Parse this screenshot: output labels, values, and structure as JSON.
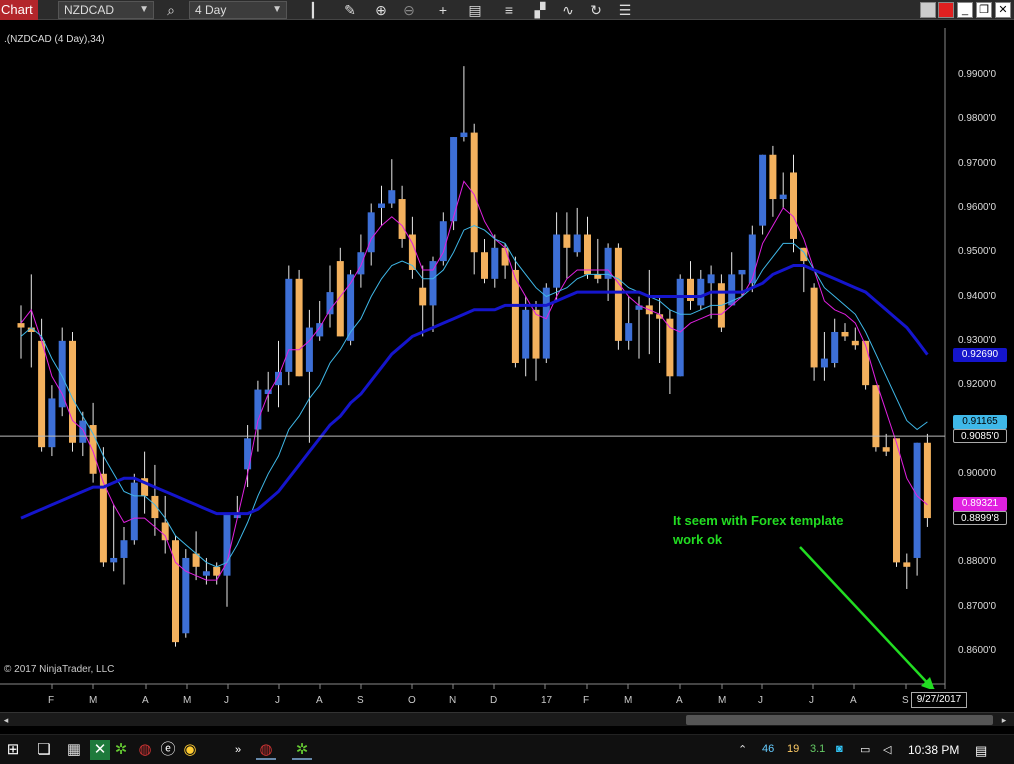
{
  "toolbar": {
    "tab_label": "Chart",
    "instrument": "NZDCAD",
    "period": "4 Day",
    "colors": {
      "tab": "#b3262b",
      "bar": "#2b2b2b"
    },
    "icons": [
      "search-icon",
      "candlestick-icon",
      "pencil-icon",
      "zoom-in-icon",
      "zoom-out-icon",
      "crosshair-icon",
      "data-box-icon",
      "bars-icon",
      "strategy-icon",
      "indicator-icon",
      "refresh-icon",
      "properties-icon"
    ],
    "window_buttons": [
      "restore-icon",
      "close-red-icon",
      "minimize-icon",
      "maximize-icon",
      "close-icon"
    ]
  },
  "chart": {
    "title": ".(NZDCAD (4 Day),34)",
    "copyright": "© 2017 NinjaTrader, LLC",
    "annotation_line1": "It seem with Forex template",
    "annotation_line2": "work ok",
    "date_tag": "9/27/2017",
    "price_ticks": [
      "0.9900'0",
      "0.9800'0",
      "0.9700'0",
      "0.9600'0",
      "0.9500'0",
      "0.9400'0",
      "0.9300'0",
      "0.9200'0",
      "0.9100'0",
      "0.9000'0",
      "0.8900'0",
      "0.8800'0",
      "0.8700'0",
      "0.8600'0"
    ],
    "price_tags": [
      {
        "text": "0.92690",
        "color": "#1515cc",
        "fg": "#ffffff"
      },
      {
        "text": "0.91165",
        "color": "#3fb8e8",
        "fg": "#000000"
      },
      {
        "text": "0.9085'0",
        "color": "#000000",
        "fg": "#ffffff"
      },
      {
        "text": "0.89321",
        "color": "#e020e0",
        "fg": "#ffffff"
      },
      {
        "text": "0.8899'8",
        "color": "#000000",
        "fg": "#ffffff"
      }
    ],
    "month_labels": [
      "F",
      "M",
      "A",
      "M",
      "J",
      "J",
      "A",
      "S",
      "O",
      "N",
      "D",
      "17",
      "F",
      "M",
      "A",
      "M",
      "J",
      "J",
      "A",
      "S"
    ],
    "colors": {
      "up": "#3d6fd6",
      "down": "#f3b15e",
      "ema_fast": "#e020e0",
      "ema_mid": "#3fb8e8",
      "ema_slow": "#1515cc",
      "annotation": "#22dd22"
    }
  },
  "chart_data": {
    "type": "candlestick",
    "instrument": "NZDCAD",
    "period": "4 Day",
    "ylim": [
      0.855,
      0.995
    ],
    "current_price": 0.9085,
    "candles": [
      {
        "o": 0.934,
        "h": 0.938,
        "l": 0.926,
        "c": 0.933
      },
      {
        "o": 0.933,
        "h": 0.945,
        "l": 0.924,
        "c": 0.932
      },
      {
        "o": 0.93,
        "h": 0.935,
        "l": 0.905,
        "c": 0.906
      },
      {
        "o": 0.906,
        "h": 0.92,
        "l": 0.904,
        "c": 0.917
      },
      {
        "o": 0.915,
        "h": 0.933,
        "l": 0.913,
        "c": 0.93
      },
      {
        "o": 0.93,
        "h": 0.932,
        "l": 0.905,
        "c": 0.907
      },
      {
        "o": 0.907,
        "h": 0.914,
        "l": 0.904,
        "c": 0.912
      },
      {
        "o": 0.911,
        "h": 0.916,
        "l": 0.898,
        "c": 0.9
      },
      {
        "o": 0.9,
        "h": 0.906,
        "l": 0.879,
        "c": 0.88
      },
      {
        "o": 0.88,
        "h": 0.893,
        "l": 0.878,
        "c": 0.881
      },
      {
        "o": 0.881,
        "h": 0.888,
        "l": 0.875,
        "c": 0.885
      },
      {
        "o": 0.885,
        "h": 0.9,
        "l": 0.884,
        "c": 0.898
      },
      {
        "o": 0.899,
        "h": 0.905,
        "l": 0.891,
        "c": 0.895
      },
      {
        "o": 0.895,
        "h": 0.902,
        "l": 0.886,
        "c": 0.89
      },
      {
        "o": 0.889,
        "h": 0.895,
        "l": 0.882,
        "c": 0.885
      },
      {
        "o": 0.885,
        "h": 0.886,
        "l": 0.861,
        "c": 0.862
      },
      {
        "o": 0.864,
        "h": 0.883,
        "l": 0.863,
        "c": 0.881
      },
      {
        "o": 0.882,
        "h": 0.887,
        "l": 0.876,
        "c": 0.879
      },
      {
        "o": 0.877,
        "h": 0.881,
        "l": 0.875,
        "c": 0.878
      },
      {
        "o": 0.879,
        "h": 0.88,
        "l": 0.875,
        "c": 0.877
      },
      {
        "o": 0.877,
        "h": 0.887,
        "l": 0.87,
        "c": 0.891
      },
      {
        "o": 0.89,
        "h": 0.895,
        "l": 0.89,
        "c": 0.891
      },
      {
        "o": 0.901,
        "h": 0.911,
        "l": 0.897,
        "c": 0.908
      },
      {
        "o": 0.91,
        "h": 0.921,
        "l": 0.905,
        "c": 0.919
      },
      {
        "o": 0.918,
        "h": 0.923,
        "l": 0.914,
        "c": 0.919
      },
      {
        "o": 0.92,
        "h": 0.93,
        "l": 0.915,
        "c": 0.923
      },
      {
        "o": 0.923,
        "h": 0.947,
        "l": 0.92,
        "c": 0.944
      },
      {
        "o": 0.944,
        "h": 0.946,
        "l": 0.93,
        "c": 0.922
      },
      {
        "o": 0.923,
        "h": 0.937,
        "l": 0.907,
        "c": 0.933
      },
      {
        "o": 0.931,
        "h": 0.939,
        "l": 0.93,
        "c": 0.934
      },
      {
        "o": 0.936,
        "h": 0.947,
        "l": 0.933,
        "c": 0.941
      },
      {
        "o": 0.948,
        "h": 0.951,
        "l": 0.931,
        "c": 0.931
      },
      {
        "o": 0.93,
        "h": 0.946,
        "l": 0.929,
        "c": 0.945
      },
      {
        "o": 0.945,
        "h": 0.954,
        "l": 0.942,
        "c": 0.95
      },
      {
        "o": 0.95,
        "h": 0.961,
        "l": 0.947,
        "c": 0.959
      },
      {
        "o": 0.96,
        "h": 0.965,
        "l": 0.956,
        "c": 0.961
      },
      {
        "o": 0.961,
        "h": 0.971,
        "l": 0.96,
        "c": 0.964
      },
      {
        "o": 0.962,
        "h": 0.965,
        "l": 0.951,
        "c": 0.953
      },
      {
        "o": 0.954,
        "h": 0.958,
        "l": 0.944,
        "c": 0.946
      },
      {
        "o": 0.942,
        "h": 0.947,
        "l": 0.931,
        "c": 0.938
      },
      {
        "o": 0.938,
        "h": 0.949,
        "l": 0.932,
        "c": 0.948
      },
      {
        "o": 0.948,
        "h": 0.959,
        "l": 0.947,
        "c": 0.957
      },
      {
        "o": 0.957,
        "h": 0.976,
        "l": 0.955,
        "c": 0.976
      },
      {
        "o": 0.976,
        "h": 0.992,
        "l": 0.975,
        "c": 0.977
      },
      {
        "o": 0.977,
        "h": 0.979,
        "l": 0.945,
        "c": 0.95
      },
      {
        "o": 0.95,
        "h": 0.953,
        "l": 0.943,
        "c": 0.944
      },
      {
        "o": 0.944,
        "h": 0.954,
        "l": 0.942,
        "c": 0.951
      },
      {
        "o": 0.951,
        "h": 0.952,
        "l": 0.944,
        "c": 0.947
      },
      {
        "o": 0.946,
        "h": 0.949,
        "l": 0.924,
        "c": 0.925
      },
      {
        "o": 0.926,
        "h": 0.94,
        "l": 0.922,
        "c": 0.937
      },
      {
        "o": 0.937,
        "h": 0.939,
        "l": 0.921,
        "c": 0.926
      },
      {
        "o": 0.926,
        "h": 0.943,
        "l": 0.925,
        "c": 0.942
      },
      {
        "o": 0.942,
        "h": 0.959,
        "l": 0.939,
        "c": 0.954
      },
      {
        "o": 0.954,
        "h": 0.959,
        "l": 0.944,
        "c": 0.951
      },
      {
        "o": 0.95,
        "h": 0.96,
        "l": 0.949,
        "c": 0.954
      },
      {
        "o": 0.954,
        "h": 0.958,
        "l": 0.944,
        "c": 0.945
      },
      {
        "o": 0.945,
        "h": 0.953,
        "l": 0.943,
        "c": 0.944
      },
      {
        "o": 0.944,
        "h": 0.952,
        "l": 0.939,
        "c": 0.951
      },
      {
        "o": 0.951,
        "h": 0.952,
        "l": 0.928,
        "c": 0.93
      },
      {
        "o": 0.93,
        "h": 0.94,
        "l": 0.928,
        "c": 0.934
      },
      {
        "o": 0.937,
        "h": 0.94,
        "l": 0.926,
        "c": 0.938
      },
      {
        "o": 0.938,
        "h": 0.946,
        "l": 0.927,
        "c": 0.936
      },
      {
        "o": 0.936,
        "h": 0.94,
        "l": 0.925,
        "c": 0.935
      },
      {
        "o": 0.935,
        "h": 0.937,
        "l": 0.918,
        "c": 0.922
      },
      {
        "o": 0.922,
        "h": 0.945,
        "l": 0.922,
        "c": 0.944
      },
      {
        "o": 0.944,
        "h": 0.948,
        "l": 0.937,
        "c": 0.939
      },
      {
        "o": 0.938,
        "h": 0.946,
        "l": 0.937,
        "c": 0.944
      },
      {
        "o": 0.943,
        "h": 0.947,
        "l": 0.935,
        "c": 0.945
      },
      {
        "o": 0.943,
        "h": 0.945,
        "l": 0.932,
        "c": 0.933
      },
      {
        "o": 0.938,
        "h": 0.95,
        "l": 0.938,
        "c": 0.945
      },
      {
        "o": 0.945,
        "h": 0.946,
        "l": 0.94,
        "c": 0.946
      },
      {
        "o": 0.943,
        "h": 0.956,
        "l": 0.941,
        "c": 0.954
      },
      {
        "o": 0.956,
        "h": 0.97,
        "l": 0.954,
        "c": 0.972
      },
      {
        "o": 0.972,
        "h": 0.974,
        "l": 0.958,
        "c": 0.962
      },
      {
        "o": 0.962,
        "h": 0.968,
        "l": 0.96,
        "c": 0.963
      },
      {
        "o": 0.968,
        "h": 0.972,
        "l": 0.95,
        "c": 0.953
      },
      {
        "o": 0.951,
        "h": 0.949,
        "l": 0.941,
        "c": 0.948
      },
      {
        "o": 0.942,
        "h": 0.943,
        "l": 0.921,
        "c": 0.924
      },
      {
        "o": 0.924,
        "h": 0.932,
        "l": 0.921,
        "c": 0.926
      },
      {
        "o": 0.925,
        "h": 0.935,
        "l": 0.924,
        "c": 0.932
      },
      {
        "o": 0.932,
        "h": 0.934,
        "l": 0.93,
        "c": 0.931
      },
      {
        "o": 0.93,
        "h": 0.933,
        "l": 0.928,
        "c": 0.929
      },
      {
        "o": 0.93,
        "h": 0.926,
        "l": 0.919,
        "c": 0.92
      },
      {
        "o": 0.92,
        "h": 0.918,
        "l": 0.905,
        "c": 0.906
      },
      {
        "o": 0.906,
        "h": 0.909,
        "l": 0.904,
        "c": 0.905
      },
      {
        "o": 0.908,
        "h": 0.901,
        "l": 0.879,
        "c": 0.88
      },
      {
        "o": 0.88,
        "h": 0.882,
        "l": 0.874,
        "c": 0.879
      },
      {
        "o": 0.881,
        "h": 0.9,
        "l": 0.877,
        "c": 0.907
      },
      {
        "o": 0.907,
        "h": 0.909,
        "l": 0.888,
        "c": 0.89
      }
    ],
    "series": [
      {
        "name": "ema_fast",
        "values": [
          0.934,
          0.937,
          0.93,
          0.922,
          0.918,
          0.912,
          0.91,
          0.905,
          0.898,
          0.893,
          0.889,
          0.89,
          0.89,
          0.888,
          0.886,
          0.88,
          0.878,
          0.877,
          0.876,
          0.876,
          0.88,
          0.89,
          0.9,
          0.912,
          0.918,
          0.922,
          0.928,
          0.928,
          0.93,
          0.933,
          0.937,
          0.94,
          0.943,
          0.947,
          0.953,
          0.956,
          0.958,
          0.956,
          0.952,
          0.946,
          0.946,
          0.95,
          0.958,
          0.966,
          0.963,
          0.957,
          0.953,
          0.951,
          0.944,
          0.94,
          0.936,
          0.935,
          0.94,
          0.944,
          0.946,
          0.946,
          0.946,
          0.946,
          0.943,
          0.94,
          0.938,
          0.937,
          0.936,
          0.933,
          0.932,
          0.934,
          0.935,
          0.936,
          0.936,
          0.938,
          0.94,
          0.944,
          0.952,
          0.956,
          0.96,
          0.958,
          0.953,
          0.946,
          0.939,
          0.937,
          0.936,
          0.934,
          0.929,
          0.921,
          0.914,
          0.907,
          0.899,
          0.895,
          0.893
        ]
      },
      {
        "name": "ema_mid",
        "values": [
          0.931,
          0.933,
          0.931,
          0.926,
          0.922,
          0.917,
          0.913,
          0.909,
          0.904,
          0.9,
          0.896,
          0.895,
          0.895,
          0.893,
          0.89,
          0.886,
          0.884,
          0.882,
          0.88,
          0.879,
          0.88,
          0.884,
          0.889,
          0.895,
          0.9,
          0.904,
          0.91,
          0.913,
          0.917,
          0.92,
          0.925,
          0.928,
          0.932,
          0.935,
          0.94,
          0.944,
          0.947,
          0.948,
          0.947,
          0.944,
          0.944,
          0.946,
          0.95,
          0.955,
          0.956,
          0.955,
          0.953,
          0.952,
          0.948,
          0.945,
          0.942,
          0.94,
          0.941,
          0.942,
          0.944,
          0.945,
          0.945,
          0.945,
          0.944,
          0.942,
          0.941,
          0.94,
          0.939,
          0.937,
          0.936,
          0.936,
          0.937,
          0.938,
          0.938,
          0.939,
          0.94,
          0.942,
          0.946,
          0.949,
          0.952,
          0.952,
          0.95,
          0.946,
          0.942,
          0.94,
          0.938,
          0.936,
          0.932,
          0.927,
          0.922,
          0.917,
          0.912,
          0.91,
          0.9117
        ]
      },
      {
        "name": "ema_slow",
        "values": [
          0.89,
          0.891,
          0.892,
          0.893,
          0.894,
          0.895,
          0.896,
          0.897,
          0.897,
          0.898,
          0.899,
          0.899,
          0.898,
          0.897,
          0.896,
          0.895,
          0.894,
          0.893,
          0.892,
          0.891,
          0.891,
          0.891,
          0.891,
          0.892,
          0.894,
          0.896,
          0.899,
          0.902,
          0.905,
          0.908,
          0.911,
          0.913,
          0.916,
          0.918,
          0.921,
          0.924,
          0.927,
          0.929,
          0.931,
          0.932,
          0.933,
          0.934,
          0.935,
          0.936,
          0.937,
          0.937,
          0.937,
          0.938,
          0.938,
          0.938,
          0.938,
          0.938,
          0.939,
          0.94,
          0.941,
          0.941,
          0.941,
          0.941,
          0.941,
          0.941,
          0.941,
          0.94,
          0.94,
          0.94,
          0.94,
          0.94,
          0.94,
          0.941,
          0.941,
          0.941,
          0.941,
          0.942,
          0.943,
          0.945,
          0.946,
          0.947,
          0.947,
          0.946,
          0.945,
          0.944,
          0.943,
          0.942,
          0.941,
          0.939,
          0.937,
          0.935,
          0.933,
          0.93,
          0.9269
        ]
      }
    ]
  },
  "scrollbar": {
    "left_arrow": "◂",
    "right_arrow": "▸"
  },
  "taskbar": {
    "clock": "10:38 PM",
    "tray_numbers": [
      "46",
      "19",
      "3.1"
    ],
    "apps": [
      "windows-start-icon",
      "task-view-icon",
      "calculator-icon",
      "excel-icon",
      "ninjatrader-icon",
      "app-icon",
      "ee-app-icon",
      "chrome-icon",
      "ninjatrader-running-icon",
      "ninjatrader-icon-2"
    ]
  }
}
